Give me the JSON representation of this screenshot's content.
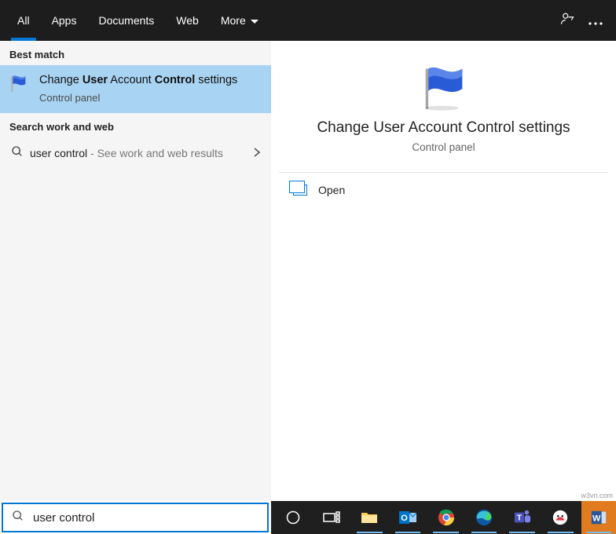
{
  "topbar": {
    "tabs": [
      "All",
      "Apps",
      "Documents",
      "Web",
      "More"
    ]
  },
  "left": {
    "best_match_label": "Best match",
    "result": {
      "line_pre": "Change ",
      "b1": "User",
      "mid": " Account ",
      "b2": "Control",
      "line_post": " settings",
      "sub": "Control panel"
    },
    "work_web_label": "Search work and web",
    "web_item": {
      "text": "user control",
      "hint": " - See work and web results"
    }
  },
  "preview": {
    "title": "Change User Account Control settings",
    "sub": "Control panel",
    "action": "Open"
  },
  "search": {
    "value": "user control"
  },
  "watermark": "w3vn.com"
}
